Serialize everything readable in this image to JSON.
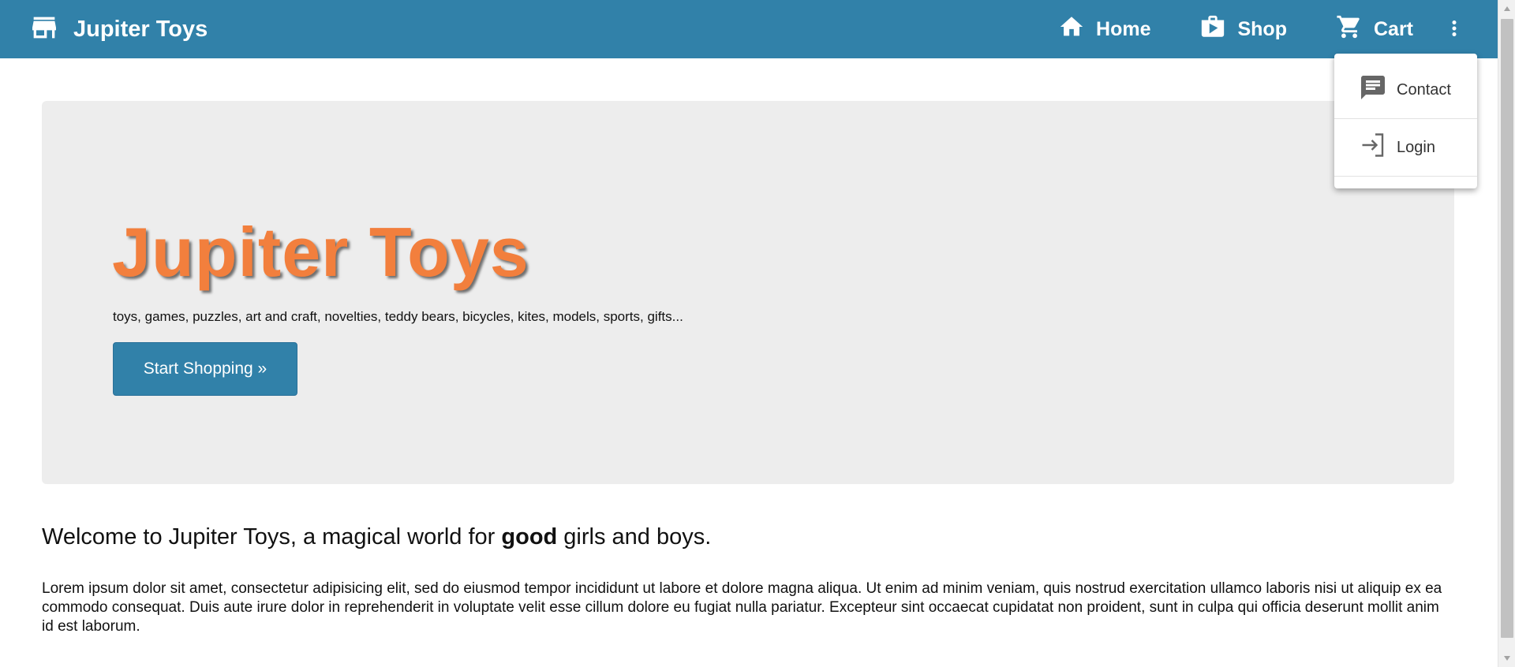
{
  "navbar": {
    "brand": "Jupiter Toys",
    "brand_icon": "store-icon",
    "links": [
      {
        "label": "Home",
        "icon": "home-icon"
      },
      {
        "label": "Shop",
        "icon": "shop-bag-icon"
      },
      {
        "label": "Cart",
        "icon": "cart-icon"
      }
    ],
    "more_icon": "more-vertical-icon",
    "color": "#3181a9"
  },
  "menu": {
    "items": [
      {
        "label": "Contact",
        "icon": "message-icon"
      },
      {
        "label": "Login",
        "icon": "login-icon"
      }
    ]
  },
  "hero": {
    "title": "Jupiter Toys",
    "subtitle": "toys, games, puzzles, art and craft, novelties, teddy bears, bicycles, kites, models, sports, gifts...",
    "button_label": "Start Shopping »",
    "title_color": "#f27f3d",
    "background": "#ededed"
  },
  "content": {
    "welcome_before": "Welcome to Jupiter Toys, a magical world for ",
    "welcome_bold": "good",
    "welcome_after": " girls and boys.",
    "body": "Lorem ipsum dolor sit amet, consectetur adipisicing elit, sed do eiusmod tempor incididunt ut labore et dolore magna aliqua. Ut enim ad minim veniam, quis nostrud exercitation ullamco laboris nisi ut aliquip ex ea commodo consequat. Duis aute irure dolor in reprehenderit in voluptate velit esse cillum dolore eu fugiat nulla pariatur. Excepteur sint occaecat cupidatat non proident, sunt in culpa qui officia deserunt mollit anim id est laborum."
  }
}
